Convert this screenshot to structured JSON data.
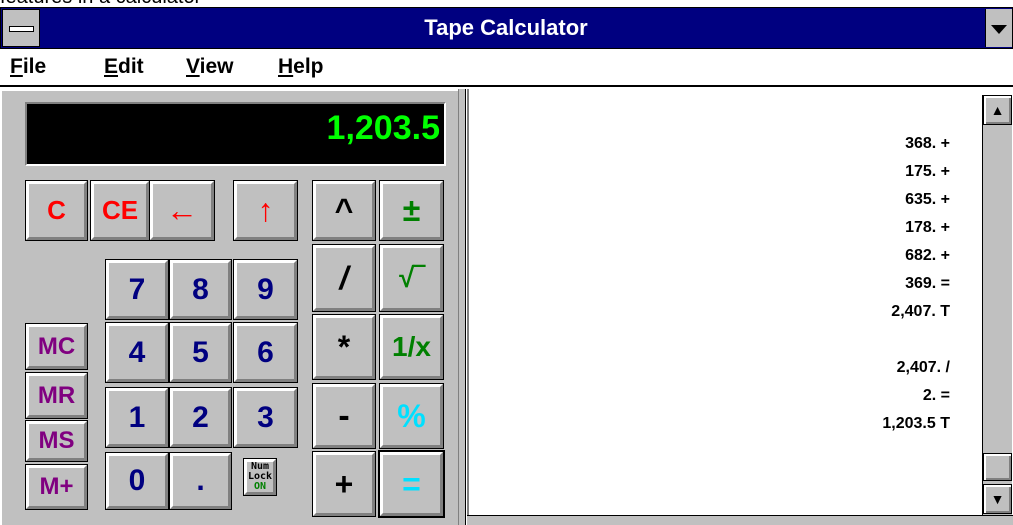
{
  "caption_fragment": "features in a calculator",
  "window": {
    "title": "Tape Calculator"
  },
  "menu": [
    {
      "first": "F",
      "rest": "ile"
    },
    {
      "first": "E",
      "rest": "dit"
    },
    {
      "first": "V",
      "rest": "iew"
    },
    {
      "first": "H",
      "rest": "elp"
    }
  ],
  "display": {
    "value": "1,203.5",
    "color": "#00ff00"
  },
  "buttons": {
    "clear": "C",
    "clear_entry": "CE",
    "backspace": "←",
    "up": "↑",
    "power": "^",
    "plus_minus": "±",
    "divide": "/",
    "sqrt": "√‾",
    "multiply": "*",
    "reciprocal": "1/x",
    "minus": "-",
    "percent": "%",
    "plus": "+",
    "equals": "=",
    "mem_clear": "MC",
    "mem_recall": "MR",
    "mem_store": "MS",
    "mem_add": "M+",
    "digits": [
      "0",
      "1",
      "2",
      "3",
      "4",
      "5",
      "6",
      "7",
      "8",
      "9"
    ],
    "decimal": ".",
    "numlock": {
      "line1": "Num",
      "line2": "Lock",
      "line3": "ON"
    }
  },
  "tape": [
    "368. +",
    "175. +",
    "635. +",
    "178. +",
    "682. +",
    "369. =",
    "2,407. T",
    "",
    "2,407. /",
    "2. =",
    "1,203.5 T"
  ],
  "scrollbar": {
    "up_icon": "up-arrow-icon",
    "down_icon": "down-arrow-icon"
  },
  "colors": {
    "titlebar": "#000080",
    "face": "#c0c0c0",
    "red": "#ff0000",
    "navy": "#000080",
    "green": "#008000",
    "cyan": "#00e0ff",
    "purple": "#800080"
  }
}
